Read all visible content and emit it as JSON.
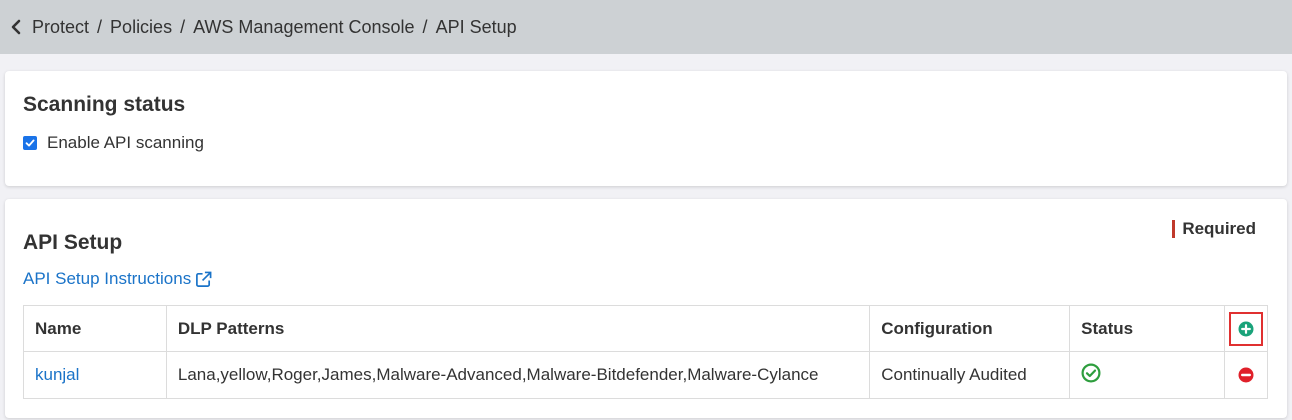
{
  "breadcrumb": {
    "items": [
      "Protect",
      "Policies",
      "AWS Management Console",
      "API Setup"
    ],
    "separator": "/"
  },
  "scanning": {
    "title": "Scanning status",
    "checkbox_label": "Enable API scanning",
    "checked": true
  },
  "api_setup": {
    "title": "API Setup",
    "required_label": "Required",
    "instructions_link": "API Setup Instructions",
    "table": {
      "headers": [
        "Name",
        "DLP Patterns",
        "Configuration",
        "Status"
      ],
      "rows": [
        {
          "name": "kunjal",
          "dlp_patterns": "Lana,yellow,Roger,James,Malware-Advanced,Malware-Bitdefender,Malware-Cylance",
          "configuration": "Continually Audited",
          "status_icon": "check-circle-icon"
        }
      ]
    }
  },
  "colors": {
    "accent": "#1a73c8",
    "success": "#2e9e3e",
    "danger": "#e0202a",
    "add": "#1aa37a",
    "topbar": "#cdd1d4"
  }
}
